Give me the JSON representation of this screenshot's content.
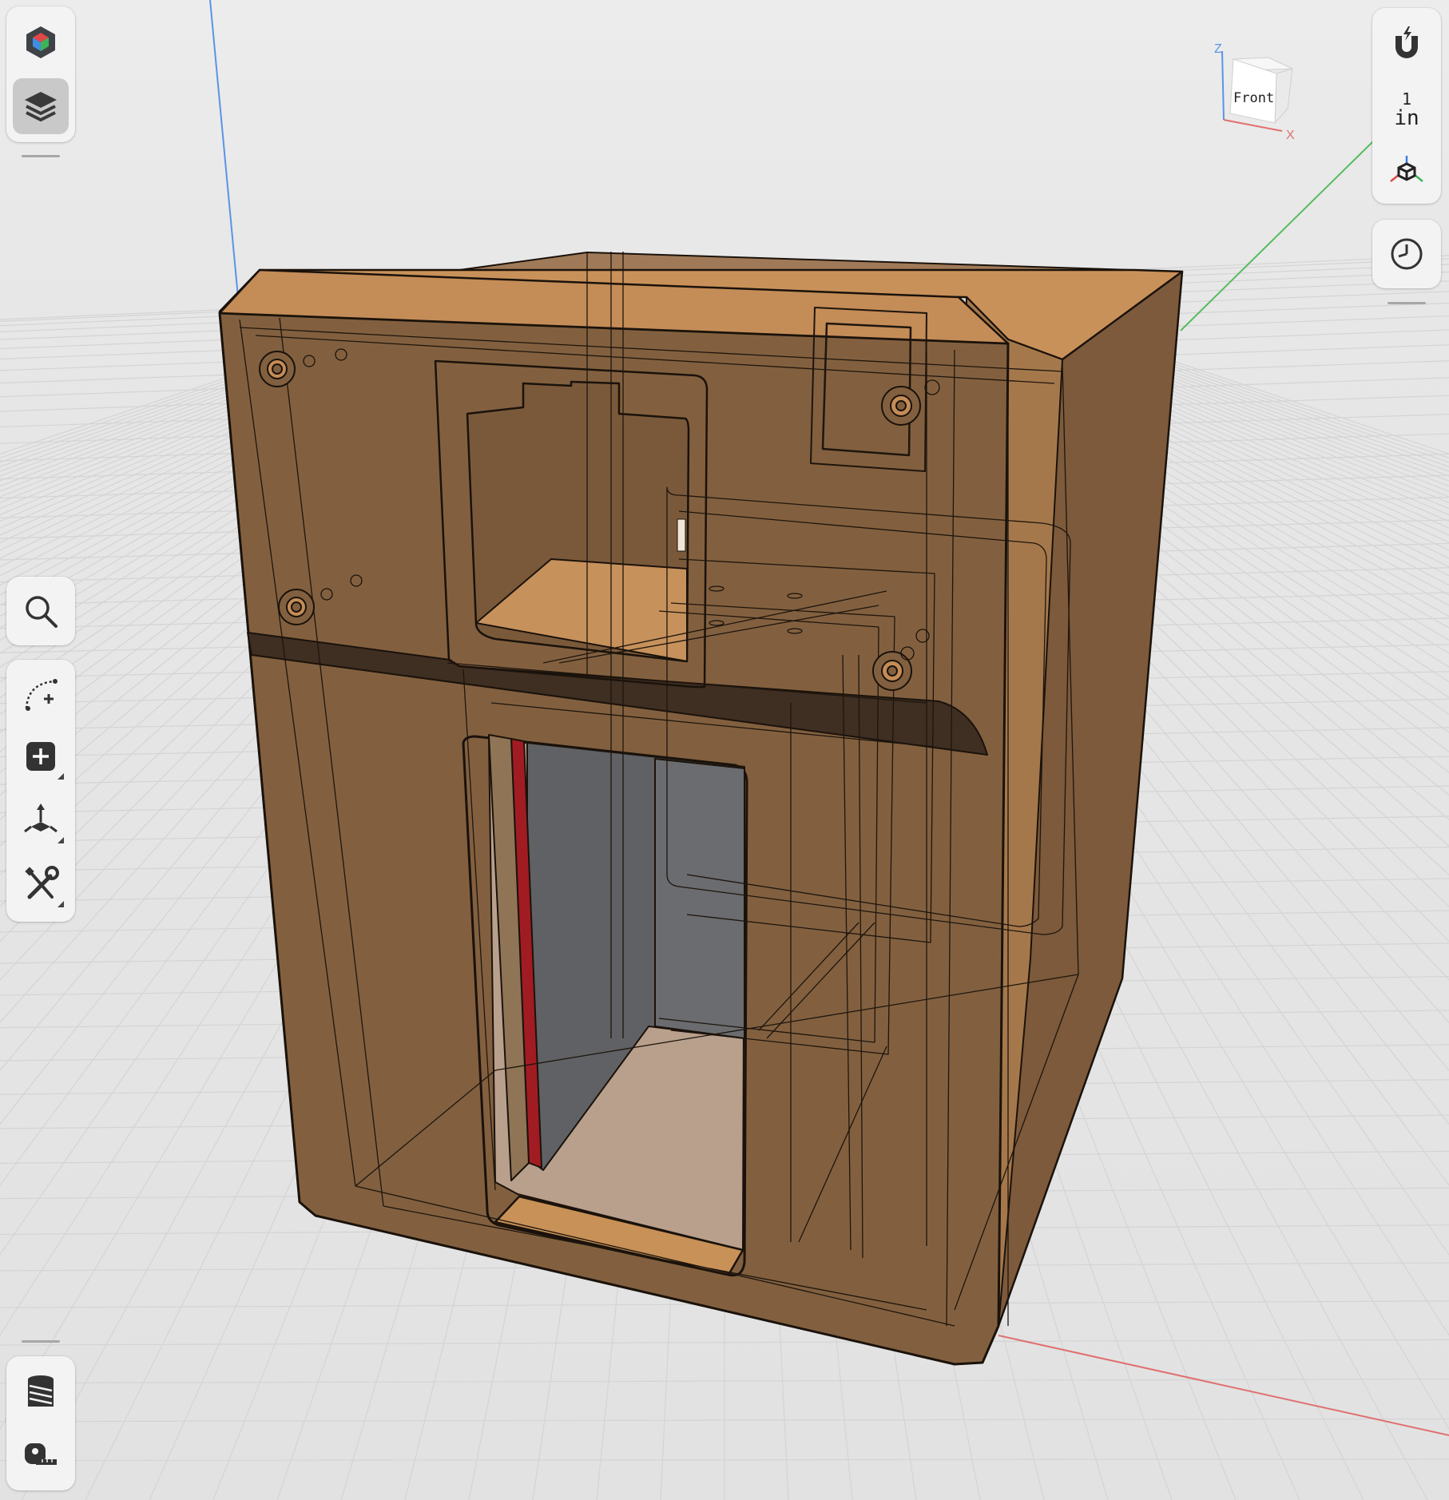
{
  "app": {
    "left_toolbar": {
      "top": [
        "app-cube",
        "layers"
      ],
      "middle": [
        "search",
        "sketch-curve",
        "add-primitive",
        "transform",
        "tools"
      ],
      "bottom": [
        "thread",
        "measure"
      ]
    },
    "right_toolbar": {
      "snap": "magnet",
      "units_value": "1",
      "units_label": "in",
      "view": "orientation-cube",
      "history": "history-clock"
    },
    "view_cube": {
      "face_label": "Front",
      "axis_z": "Z",
      "axis_x": "X"
    }
  },
  "colors": {
    "background": "#e9e9e9",
    "grid": "#d8d8d8",
    "body": "#82603f",
    "body_light": "#c8935e",
    "body_dark": "#3f2e22",
    "red_part": "#a11c22",
    "dark_part": "#5f6164",
    "axis_x": "#e06a6a",
    "axis_y": "#52b95a",
    "axis_z": "#4c8be6"
  }
}
